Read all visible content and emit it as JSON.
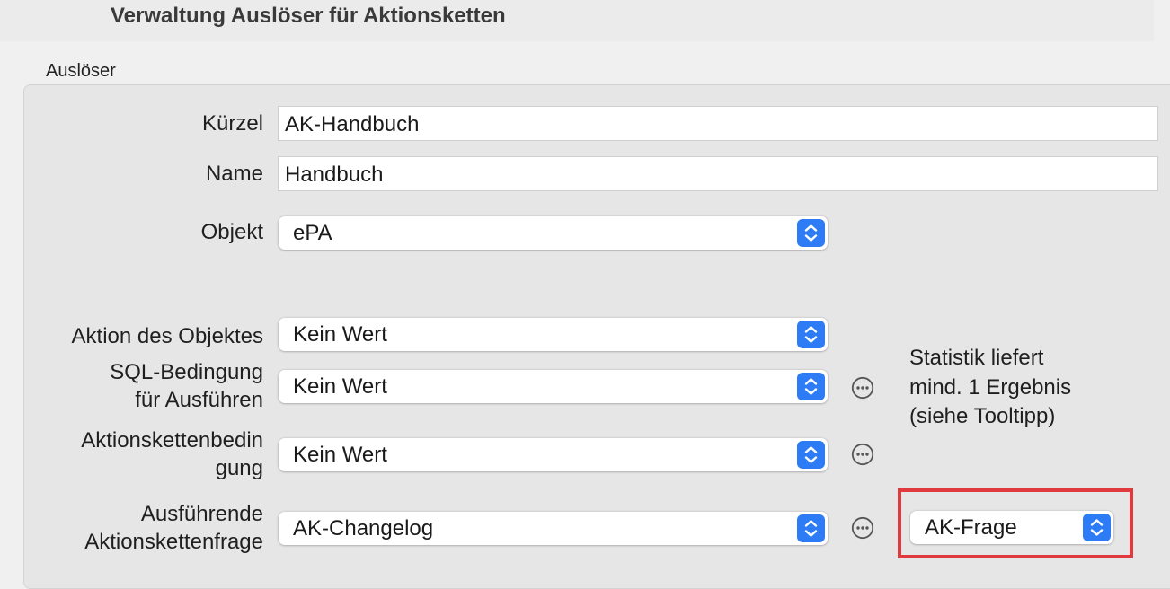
{
  "window": {
    "title": "Verwaltung Auslöser für Aktionsketten"
  },
  "group": {
    "label": "Auslöser"
  },
  "form": {
    "kuerzel": {
      "label": "Kürzel",
      "value": "AK-Handbuch"
    },
    "name": {
      "label": "Name",
      "value": "Handbuch"
    },
    "objekt": {
      "label": "Objekt",
      "value": "ePA"
    },
    "aktion": {
      "label": "Aktion des Objektes",
      "value": "Kein Wert"
    },
    "sql": {
      "label_line1": "SQL-Bedingung",
      "label_line2": "für Ausführen",
      "value": "Kein Wert"
    },
    "ak_bedingung": {
      "label_line1": "Aktionskettenbedin",
      "label_line2": "gung",
      "value": "Kein Wert"
    },
    "ak_frage": {
      "label_line1": "Ausführende",
      "label_line2": "Aktionskettenfrage",
      "value": "AK-Changelog",
      "secondary_value": "AK-Frage"
    }
  },
  "statistik_note": {
    "line1": "Statistik liefert",
    "line2": "mind. 1 Ergebnis",
    "line3": "(siehe Tooltipp)"
  },
  "icons": {
    "popup_stepper": "up-down-chevron-icon",
    "more": "ellipsis-circle-icon"
  },
  "colors": {
    "accent": "#2d7cf6",
    "highlight": "#e0393e"
  }
}
